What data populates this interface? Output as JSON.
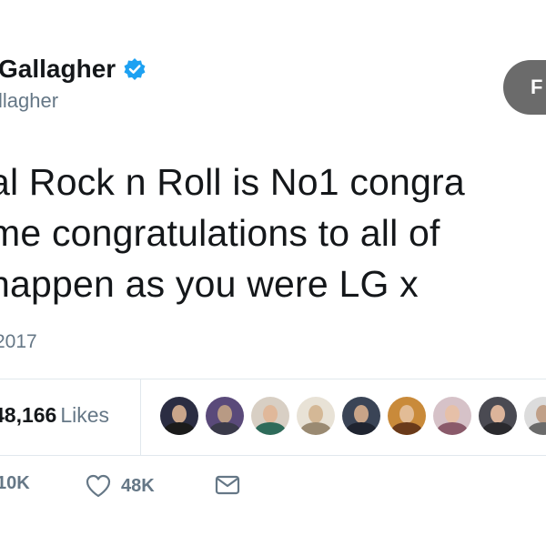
{
  "user": {
    "display_name": "Gallagher",
    "handle": "llagher",
    "verified_icon": "verified-badge-icon"
  },
  "follow_button": {
    "label": "F"
  },
  "tweet": {
    "lines": [
      "al Rock n Roll is No1 congra",
      "me congratulations to all of",
      "happen as you were LG x"
    ],
    "timestamp": "2017"
  },
  "stats": {
    "likes_count": "48,166",
    "likes_label": "Likes",
    "avatar_count": 9
  },
  "actions": {
    "retweet_count": "10K",
    "like_count": "48K",
    "like_icon": "heart-icon",
    "dm_icon": "envelope-icon"
  },
  "colors": {
    "text": "#14171a",
    "secondary": "#657786",
    "verified": "#1da1f2",
    "follow_bg": "#6b6b6b",
    "divider": "#e1e8ed"
  }
}
